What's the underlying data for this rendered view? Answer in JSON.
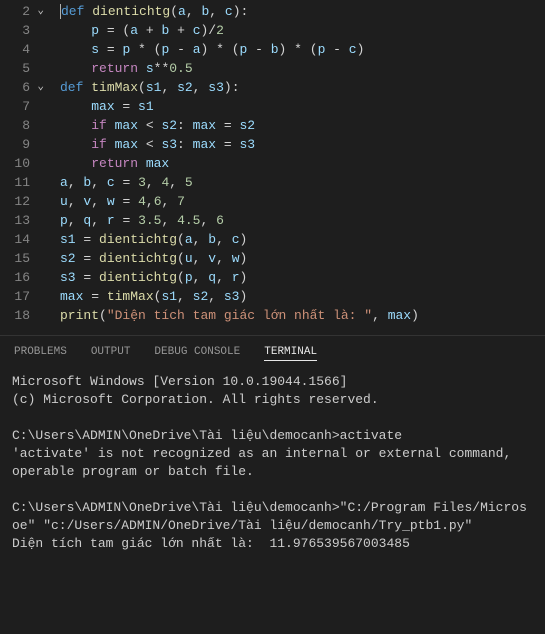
{
  "editor": {
    "lines": [
      {
        "num": "2",
        "fold": true,
        "tokens": [
          {
            "t": "def ",
            "c": "k-def cursor"
          },
          {
            "t": "dientichtg",
            "c": "fn"
          },
          {
            "t": "(",
            "c": "pn"
          },
          {
            "t": "a",
            "c": "param"
          },
          {
            "t": ", ",
            "c": "pn"
          },
          {
            "t": "b",
            "c": "param"
          },
          {
            "t": ", ",
            "c": "pn"
          },
          {
            "t": "c",
            "c": "param"
          },
          {
            "t": "):",
            "c": "pn"
          }
        ]
      },
      {
        "num": "3",
        "indent": 1,
        "tokens": [
          {
            "t": "p",
            "c": "var"
          },
          {
            "t": " = (",
            "c": "op"
          },
          {
            "t": "a",
            "c": "var"
          },
          {
            "t": " + ",
            "c": "op"
          },
          {
            "t": "b",
            "c": "var"
          },
          {
            "t": " + ",
            "c": "op"
          },
          {
            "t": "c",
            "c": "var"
          },
          {
            "t": ")/",
            "c": "op"
          },
          {
            "t": "2",
            "c": "num"
          }
        ]
      },
      {
        "num": "4",
        "indent": 1,
        "tokens": [
          {
            "t": "s",
            "c": "var"
          },
          {
            "t": " = ",
            "c": "op"
          },
          {
            "t": "p",
            "c": "var"
          },
          {
            "t": " * (",
            "c": "op"
          },
          {
            "t": "p",
            "c": "var"
          },
          {
            "t": " - ",
            "c": "op"
          },
          {
            "t": "a",
            "c": "var"
          },
          {
            "t": ") * (",
            "c": "op"
          },
          {
            "t": "p",
            "c": "var"
          },
          {
            "t": " - ",
            "c": "op"
          },
          {
            "t": "b",
            "c": "var"
          },
          {
            "t": ") * (",
            "c": "op"
          },
          {
            "t": "p",
            "c": "var"
          },
          {
            "t": " - ",
            "c": "op"
          },
          {
            "t": "c",
            "c": "var"
          },
          {
            "t": ")",
            "c": "op"
          }
        ]
      },
      {
        "num": "5",
        "indent": 1,
        "tokens": [
          {
            "t": "return ",
            "c": "k-ret"
          },
          {
            "t": "s",
            "c": "var"
          },
          {
            "t": "**",
            "c": "op"
          },
          {
            "t": "0.5",
            "c": "num"
          }
        ]
      },
      {
        "num": "6",
        "fold": true,
        "tokens": [
          {
            "t": "def ",
            "c": "k-def"
          },
          {
            "t": "timMax",
            "c": "fn"
          },
          {
            "t": "(",
            "c": "pn"
          },
          {
            "t": "s1",
            "c": "param"
          },
          {
            "t": ", ",
            "c": "pn"
          },
          {
            "t": "s2",
            "c": "param"
          },
          {
            "t": ", ",
            "c": "pn"
          },
          {
            "t": "s3",
            "c": "param"
          },
          {
            "t": "):",
            "c": "pn"
          }
        ]
      },
      {
        "num": "7",
        "indent": 1,
        "tokens": [
          {
            "t": "max",
            "c": "var"
          },
          {
            "t": " = ",
            "c": "op"
          },
          {
            "t": "s1",
            "c": "var"
          }
        ]
      },
      {
        "num": "8",
        "indent": 1,
        "tokens": [
          {
            "t": "if ",
            "c": "k-ret"
          },
          {
            "t": "max",
            "c": "var"
          },
          {
            "t": " < ",
            "c": "op"
          },
          {
            "t": "s2",
            "c": "var"
          },
          {
            "t": ": ",
            "c": "op"
          },
          {
            "t": "max",
            "c": "var"
          },
          {
            "t": " = ",
            "c": "op"
          },
          {
            "t": "s2",
            "c": "var"
          }
        ]
      },
      {
        "num": "9",
        "indent": 1,
        "tokens": [
          {
            "t": "if ",
            "c": "k-ret"
          },
          {
            "t": "max",
            "c": "var"
          },
          {
            "t": " < ",
            "c": "op"
          },
          {
            "t": "s3",
            "c": "var"
          },
          {
            "t": ": ",
            "c": "op"
          },
          {
            "t": "max",
            "c": "var"
          },
          {
            "t": " = ",
            "c": "op"
          },
          {
            "t": "s3",
            "c": "var"
          }
        ]
      },
      {
        "num": "10",
        "indent": 1,
        "tokens": [
          {
            "t": "return ",
            "c": "k-ret"
          },
          {
            "t": "max",
            "c": "var"
          }
        ]
      },
      {
        "num": "11",
        "tokens": [
          {
            "t": "a",
            "c": "var"
          },
          {
            "t": ", ",
            "c": "op"
          },
          {
            "t": "b",
            "c": "var"
          },
          {
            "t": ", ",
            "c": "op"
          },
          {
            "t": "c",
            "c": "var"
          },
          {
            "t": " = ",
            "c": "op"
          },
          {
            "t": "3",
            "c": "num"
          },
          {
            "t": ", ",
            "c": "op"
          },
          {
            "t": "4",
            "c": "num"
          },
          {
            "t": ", ",
            "c": "op"
          },
          {
            "t": "5",
            "c": "num"
          }
        ]
      },
      {
        "num": "12",
        "tokens": [
          {
            "t": "u",
            "c": "var"
          },
          {
            "t": ", ",
            "c": "op"
          },
          {
            "t": "v",
            "c": "var"
          },
          {
            "t": ", ",
            "c": "op"
          },
          {
            "t": "w",
            "c": "var"
          },
          {
            "t": " = ",
            "c": "op"
          },
          {
            "t": "4",
            "c": "num"
          },
          {
            "t": ",",
            "c": "op"
          },
          {
            "t": "6",
            "c": "num"
          },
          {
            "t": ", ",
            "c": "op"
          },
          {
            "t": "7",
            "c": "num"
          }
        ]
      },
      {
        "num": "13",
        "tokens": [
          {
            "t": "p",
            "c": "var"
          },
          {
            "t": ", ",
            "c": "op"
          },
          {
            "t": "q",
            "c": "var"
          },
          {
            "t": ", ",
            "c": "op"
          },
          {
            "t": "r",
            "c": "var"
          },
          {
            "t": " = ",
            "c": "op"
          },
          {
            "t": "3.5",
            "c": "num"
          },
          {
            "t": ", ",
            "c": "op"
          },
          {
            "t": "4.5",
            "c": "num"
          },
          {
            "t": ", ",
            "c": "op"
          },
          {
            "t": "6",
            "c": "num"
          }
        ]
      },
      {
        "num": "14",
        "tokens": [
          {
            "t": "s1",
            "c": "var"
          },
          {
            "t": " = ",
            "c": "op"
          },
          {
            "t": "dientichtg",
            "c": "fn"
          },
          {
            "t": "(",
            "c": "pn"
          },
          {
            "t": "a",
            "c": "var"
          },
          {
            "t": ", ",
            "c": "op"
          },
          {
            "t": "b",
            "c": "var"
          },
          {
            "t": ", ",
            "c": "op"
          },
          {
            "t": "c",
            "c": "var"
          },
          {
            "t": ")",
            "c": "pn"
          }
        ]
      },
      {
        "num": "15",
        "tokens": [
          {
            "t": "s2",
            "c": "var"
          },
          {
            "t": " = ",
            "c": "op"
          },
          {
            "t": "dientichtg",
            "c": "fn"
          },
          {
            "t": "(",
            "c": "pn"
          },
          {
            "t": "u",
            "c": "var"
          },
          {
            "t": ", ",
            "c": "op"
          },
          {
            "t": "v",
            "c": "var"
          },
          {
            "t": ", ",
            "c": "op"
          },
          {
            "t": "w",
            "c": "var"
          },
          {
            "t": ")",
            "c": "pn"
          }
        ]
      },
      {
        "num": "16",
        "tokens": [
          {
            "t": "s3",
            "c": "var"
          },
          {
            "t": " = ",
            "c": "op"
          },
          {
            "t": "dientichtg",
            "c": "fn"
          },
          {
            "t": "(",
            "c": "pn"
          },
          {
            "t": "p",
            "c": "var"
          },
          {
            "t": ", ",
            "c": "op"
          },
          {
            "t": "q",
            "c": "var"
          },
          {
            "t": ", ",
            "c": "op"
          },
          {
            "t": "r",
            "c": "var"
          },
          {
            "t": ")",
            "c": "pn"
          }
        ]
      },
      {
        "num": "17",
        "tokens": [
          {
            "t": "max",
            "c": "var"
          },
          {
            "t": " = ",
            "c": "op"
          },
          {
            "t": "timMax",
            "c": "fn"
          },
          {
            "t": "(",
            "c": "pn"
          },
          {
            "t": "s1",
            "c": "var"
          },
          {
            "t": ", ",
            "c": "op"
          },
          {
            "t": "s2",
            "c": "var"
          },
          {
            "t": ", ",
            "c": "op"
          },
          {
            "t": "s3",
            "c": "var"
          },
          {
            "t": ")",
            "c": "pn"
          }
        ]
      },
      {
        "num": "18",
        "tokens": [
          {
            "t": "print",
            "c": "fn"
          },
          {
            "t": "(",
            "c": "pn"
          },
          {
            "t": "\"Diện tích tam giác lớn nhất là: \"",
            "c": "str"
          },
          {
            "t": ", ",
            "c": "op"
          },
          {
            "t": "max",
            "c": "var"
          },
          {
            "t": ")",
            "c": "pn"
          }
        ]
      }
    ]
  },
  "panel": {
    "tabs": {
      "problems": "PROBLEMS",
      "output": "OUTPUT",
      "debug": "DEBUG CONSOLE",
      "terminal": "TERMINAL"
    },
    "terminal_lines": [
      "Microsoft Windows [Version 10.0.19044.1566]",
      "(c) Microsoft Corporation. All rights reserved.",
      "",
      "C:\\Users\\ADMIN\\OneDrive\\Tài liệu\\democanh>activate",
      "'activate' is not recognized as an internal or external command,",
      "operable program or batch file.",
      "",
      "C:\\Users\\ADMIN\\OneDrive\\Tài liệu\\democanh>\"C:/Program Files/Microsoe\" \"c:/Users/ADMIN/OneDrive/Tài liệu/democanh/Try_ptb1.py\"",
      "Diện tích tam giác lớn nhất là:  11.976539567003485"
    ]
  }
}
